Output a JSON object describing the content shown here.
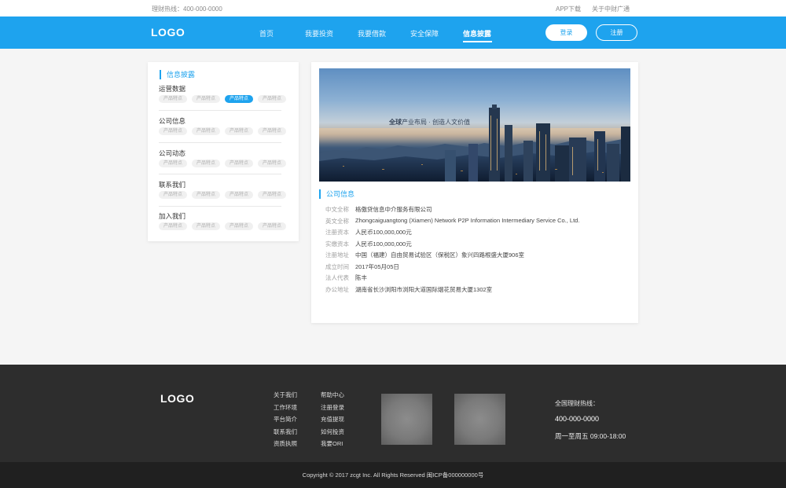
{
  "topbar": {
    "hotline": "理财热线：400-000-0000",
    "links": [
      "APP下载",
      "关于中财广通"
    ]
  },
  "nav": {
    "logo": "LOGO",
    "menu": [
      "首页",
      "我要投资",
      "我要借款",
      "安全保障",
      "信息披露"
    ],
    "active": "信息披露",
    "login": "登录",
    "register": "注册"
  },
  "sidebar": {
    "title": "信息披露",
    "groups": [
      {
        "name": "运营数据",
        "tags": [
          "产品特点",
          "产品特点",
          "产品特点",
          "产品特点"
        ],
        "active_tag": 2
      },
      {
        "name": "公司信息",
        "tags": [
          "产品特点",
          "产品特点",
          "产品特点",
          "产品特点"
        ]
      },
      {
        "name": "公司动态",
        "tags": [
          "产品特点",
          "产品特点",
          "产品特点",
          "产品特点"
        ]
      },
      {
        "name": "联系我们",
        "tags": [
          "产品特点",
          "产品特点",
          "产品特点",
          "产品特点"
        ]
      },
      {
        "name": "加入我们",
        "tags": [
          "产品特点",
          "产品特点",
          "产品特点",
          "产品特点"
        ]
      }
    ]
  },
  "banner": {
    "slogan_bold": "全球",
    "slogan_rest": "产业布局 · 创造人文价值"
  },
  "company": {
    "title": "公司信息",
    "rows": [
      {
        "k": "中文全称",
        "v": "格傲贷信息中介服务有限公司"
      },
      {
        "k": "英文全称",
        "v": "Zhongcaiguangtong (Xiamen) Network P2P Information Intermediary Service Co., Ltd."
      },
      {
        "k": "注册资本",
        "v": "人民币100,000,000元"
      },
      {
        "k": "实缴资本",
        "v": "人民币100,000,000元"
      },
      {
        "k": "注册地址",
        "v": "中国（福建）自由贸易试验区（保税区）象兴四路根盛大厦906室"
      },
      {
        "k": "成立时间",
        "v": "2017年05月05日"
      },
      {
        "k": "法人代表",
        "v": "陈丰"
      },
      {
        "k": "办公地址",
        "v": "湖南省长沙浏阳市浏阳大道国际烟花贸易大厦1302室"
      }
    ]
  },
  "footer": {
    "logo": "LOGO",
    "col1": [
      "关于我们",
      "工作环境",
      "平台简介",
      "联系我们",
      "资质执照"
    ],
    "col2": [
      "帮助中心",
      "注册登录",
      "充值提现",
      "如何投资",
      "我要ORI"
    ],
    "hotline_label": "全国理财热线：",
    "hotline": "400-000-0000",
    "hours": "周一至周五 09:00-18:00",
    "copyright": "Copyright © 2017 zcgt Inc. All Rights Reserved 闽ICP备000000000号"
  }
}
